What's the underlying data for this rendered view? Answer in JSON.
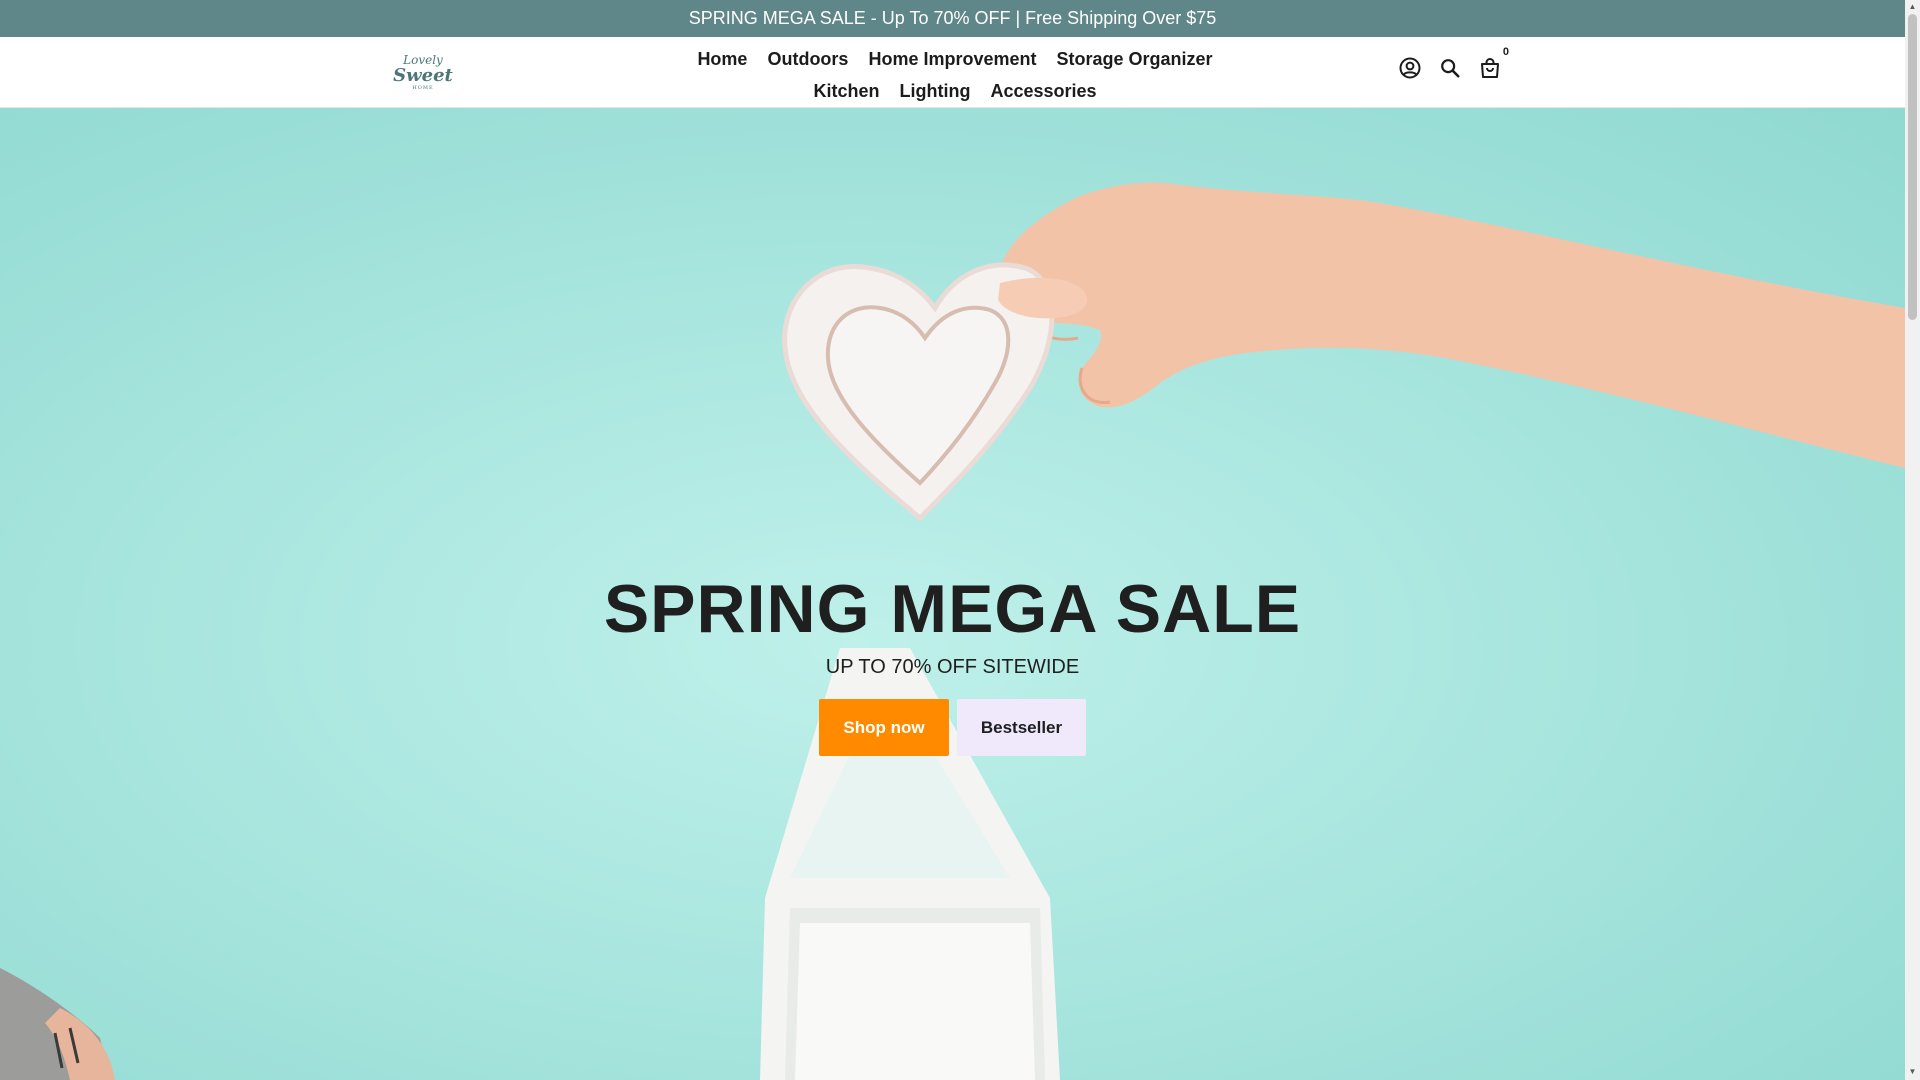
{
  "announcement": {
    "text": "SPRING MEGA SALE - Up To 70% OFF | Free Shipping Over $75"
  },
  "header": {
    "logo": {
      "line1": "Lovely",
      "line2": "Sweet",
      "line3": "HOME"
    },
    "nav_rows": [
      [
        "Home",
        "Outdoors",
        "Home Improvement",
        "Storage Organizer"
      ],
      [
        "Kitchen",
        "Lighting",
        "Accessories"
      ]
    ],
    "icons": [
      "account-icon",
      "search-icon",
      "cart-icon"
    ],
    "cart_count": "0"
  },
  "hero": {
    "title": "SPRING MEGA SALE",
    "subtitle": "UP TO 70% OFF SITEWIDE",
    "primary_button": "Shop now",
    "secondary_button": "Bestseller",
    "colors": {
      "primary_button": "#ff8a00",
      "secondary_button": "#efe9fb",
      "background": "#a9e6df"
    }
  },
  "colors": {
    "announcement_bg": "#5f8689",
    "announcement_text": "#ffffff"
  }
}
